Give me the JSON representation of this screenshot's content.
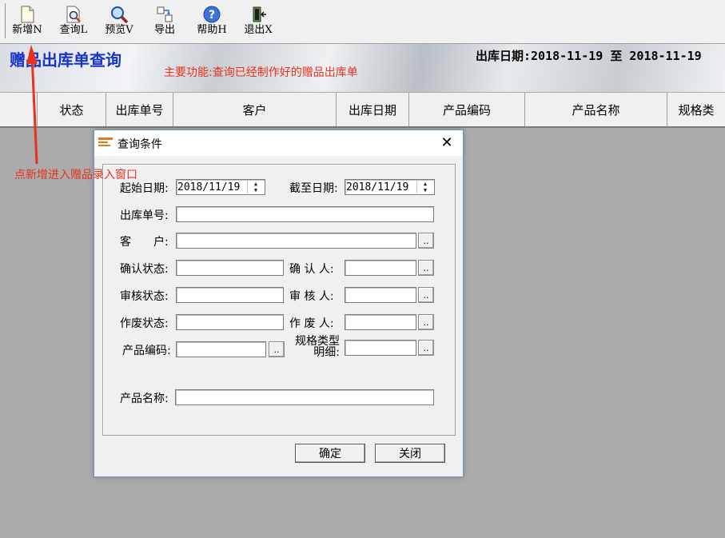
{
  "toolbar": {
    "items": [
      {
        "label": "新增N",
        "icon": "new-file-icon"
      },
      {
        "label": "查询L",
        "icon": "query-icon"
      },
      {
        "label": "预览V",
        "icon": "preview-magnifier-icon"
      },
      {
        "label": "导出",
        "icon": "export-icon"
      },
      {
        "label": "帮助H",
        "icon": "help-icon"
      },
      {
        "label": "退出X",
        "icon": "exit-door-icon"
      }
    ]
  },
  "banner": {
    "title": "赠品出库单查询",
    "date_range": "出库日期:2018-11-19 至 2018-11-19",
    "note": "主要功能:查询已经制作好的赠品出库单"
  },
  "grid": {
    "columns": [
      "状态",
      "出库单号",
      "客户",
      "出库日期",
      "产品编码",
      "产品名称",
      "规格类"
    ]
  },
  "annotation": {
    "text": "点新增进入赠品录入窗口",
    "color": "#e8311f"
  },
  "dialog": {
    "title": "查询条件",
    "close": "✕",
    "start_date_label": "起始日期:",
    "start_date_value": "2018/11/19",
    "end_date_label": "截至日期:",
    "end_date_value": "2018/11/19",
    "order_no_label": "出库单号:",
    "customer_label": "客　　户:",
    "confirm_status_label": "确认状态:",
    "confirmer_label": "确 认 人:",
    "audit_status_label": "审核状态:",
    "auditor_label": "审 核 人:",
    "void_status_label": "作废状态:",
    "voider_label": "作 废 人:",
    "product_code_label": "产品编码:",
    "spec_label_line1": "规格类型",
    "spec_label_line2": "明细:",
    "product_name_label": "产品名称:",
    "lookup": "..",
    "ok_button": "确定",
    "close_button": "关闭"
  },
  "colors": {
    "title_blue": "#1733c8",
    "annotation_red": "#e8311f",
    "dialog_border": "#6f95c8"
  }
}
